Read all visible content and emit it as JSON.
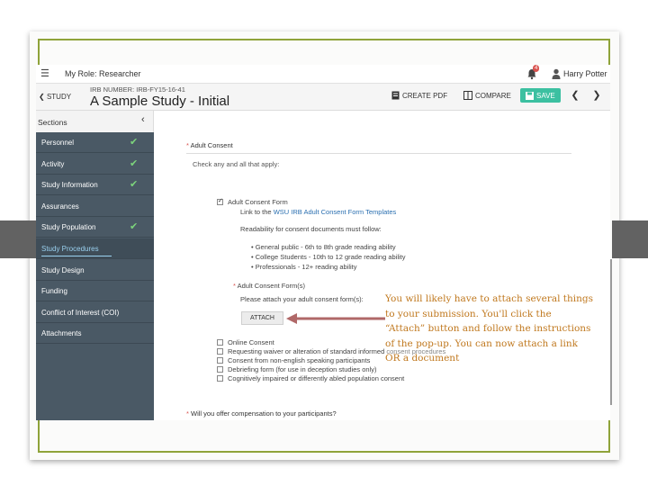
{
  "topbar": {
    "menu_icon": "hamburger-icon",
    "role_label": "My Role:",
    "role_value": "Researcher",
    "notifications_icon": "bell-icon",
    "notifications_count": "4",
    "user_icon": "user-icon",
    "user_name": "Harry Potter"
  },
  "header": {
    "back_label": "STUDY",
    "irb_number": "IRB NUMBER: IRB-FY15-16-41",
    "study_title": "A Sample Study - Initial",
    "create_pdf": "CREATE PDF",
    "compare": "COMPARE",
    "save": "SAVE",
    "save_color": "#3cc0a1"
  },
  "sidebar": {
    "title": "Sections",
    "items": [
      {
        "label": "Personnel",
        "done": true
      },
      {
        "label": "Activity",
        "done": true
      },
      {
        "label": "Study Information",
        "done": true
      },
      {
        "label": "Assurances",
        "done": false
      },
      {
        "label": "Study Population",
        "done": true
      },
      {
        "label": "Study Procedures",
        "done": false,
        "active": true
      },
      {
        "label": "Study Design",
        "done": false
      },
      {
        "label": "Funding",
        "done": false
      },
      {
        "label": "Conflict of Interest (COI)",
        "done": false
      },
      {
        "label": "Attachments",
        "done": false
      }
    ]
  },
  "content": {
    "adult_consent_question": "Adult Consent",
    "check_all": "Check any and all that apply:",
    "option_adult_form": "Adult Consent Form",
    "link_prefix": "Link to the ",
    "link_text": "WSU IRB Adult Consent Form Templates",
    "readability": "Readability for consent documents must follow:",
    "bullets": [
      "General public - 6th to 8th grade reading ability",
      "College Students - 10th to 12 grade reading ability",
      "Professionals - 12+ reading ability"
    ],
    "sub_question": "Adult Consent Form(s)",
    "attach_prompt": "Please attach your adult consent form(s):",
    "attach_button": "ATTACH",
    "other_options": [
      "Online Consent",
      "Requesting waiver or alteration of standard informed consent procedures",
      "Consent from non-english speaking participants",
      "Debriefing form (for use in deception studies only)",
      "Cognitively impaired or differently abled population consent"
    ],
    "compensation_question": "Will you offer compensation to your participants?"
  },
  "annotation": {
    "text": "You will likely have to attach several things to your submission. You'll click the “Attach” button and follow the instructions of the pop-up. You can now attach a link OR a document",
    "color": "#c0781e",
    "arrow_color": "#b06868"
  }
}
